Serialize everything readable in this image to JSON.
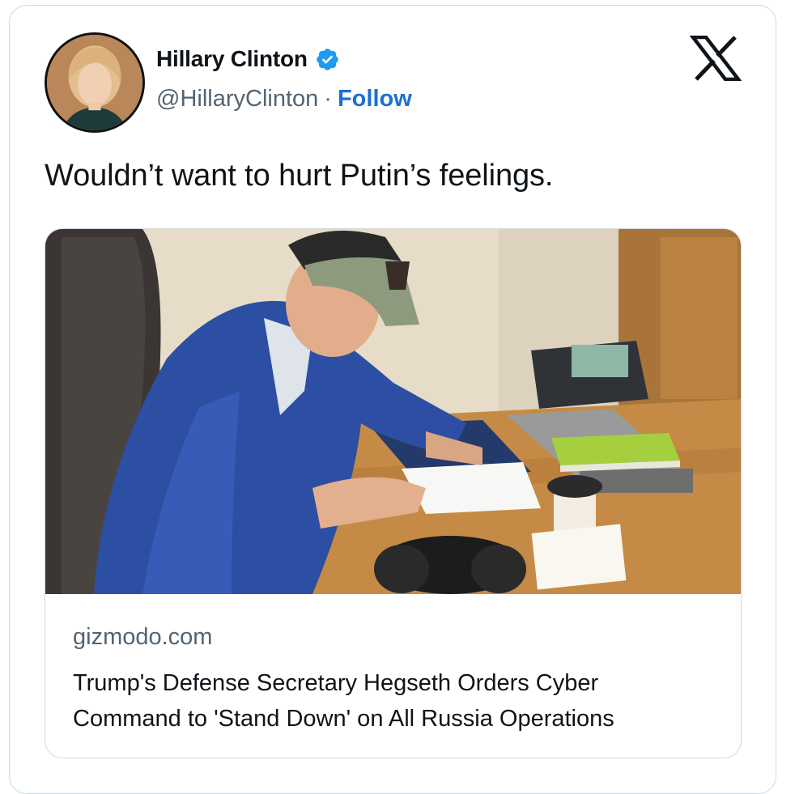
{
  "author": {
    "name": "Hillary Clinton",
    "handle": "@HillaryClinton",
    "separator": "·",
    "follow_label": "Follow",
    "verified": true
  },
  "icons": {
    "avatar": "avatar-photo",
    "verified": "verified-badge-icon",
    "platform": "x-logo-icon"
  },
  "tweet": {
    "text": "Wouldn’t want to hurt Putin’s feelings."
  },
  "link_card": {
    "image": "photo-man-signing-document-at-desk",
    "domain": "gizmodo.com",
    "headline_line1": "Trump's Defense Secretary Hegseth Orders Cyber",
    "headline_line2": "Command to 'Stand Down' on All Russia Operations"
  },
  "colors": {
    "accent": "#1d6fd6",
    "verified": "#1d9bf0",
    "secondary_text": "#536471",
    "border": "#cfd9de"
  }
}
